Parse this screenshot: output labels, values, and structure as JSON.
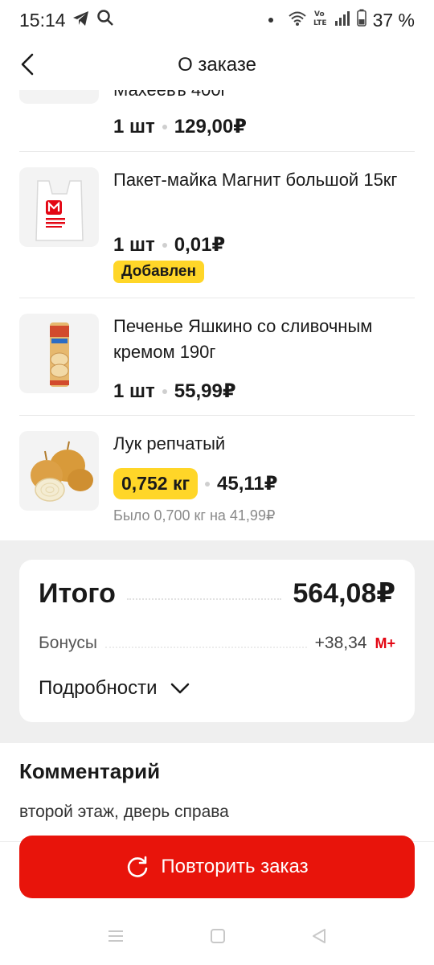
{
  "status": {
    "time": "15:14",
    "battery": "37 %",
    "icons": [
      "telegram-icon",
      "search-icon",
      "wifi-icon",
      "volte-icon",
      "signal-icon",
      "battery-icon"
    ]
  },
  "header": {
    "title": "О заказе"
  },
  "items": [
    {
      "name": "Пакет-майка Магнит большой 15кг",
      "qty": "1 шт",
      "price": "0,01₽",
      "badge": "Добавлен"
    },
    {
      "name": "Печенье Яшкино со сливочным кремом 190г",
      "qty": "1 шт",
      "price": "55,99₽"
    },
    {
      "name": "Лук репчатый",
      "qty": "0,752 кг",
      "price": "45,11₽",
      "was": "Было 0,700 кг на 41,99₽"
    }
  ],
  "partial_item": {
    "name_tail": "Махеевъ 400г",
    "qty": "1 шт",
    "price": "129,00₽"
  },
  "summary": {
    "total_label": "Итого",
    "total_value": "564,08₽",
    "bonus_label": "Бонусы",
    "bonus_value": "+38,34",
    "bonus_badge": "М+",
    "details_label": "Подробности"
  },
  "comment": {
    "title": "Комментарий",
    "text": "второй этаж, дверь справа"
  },
  "actions": {
    "repeat_label": "Повторить заказ"
  },
  "colors": {
    "accent": "#e8140b",
    "badge": "#ffd628",
    "brand_red": "#e30613"
  }
}
